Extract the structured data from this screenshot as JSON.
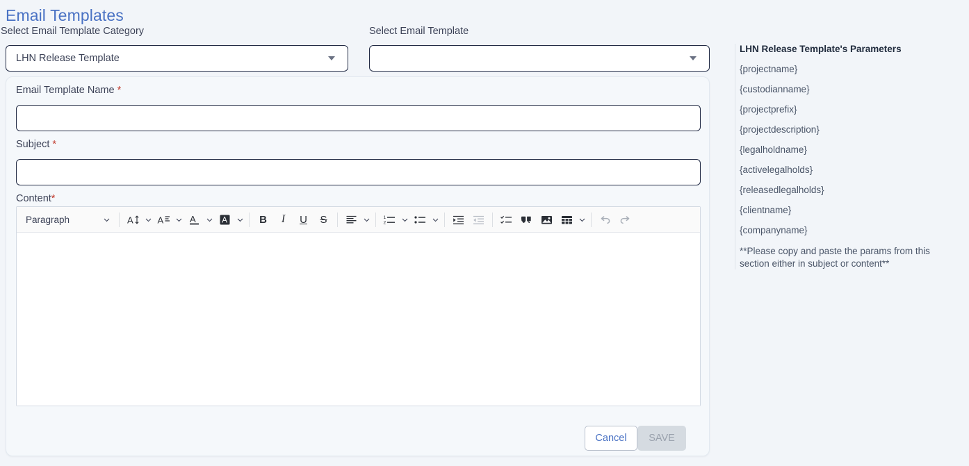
{
  "header": {
    "title": "Email Templates",
    "category_label": "Select Email Template Category",
    "template_label": "Select Email Template"
  },
  "selects": {
    "category": {
      "value": "LHN Release Template",
      "caret_icon": "chevron-down-icon"
    },
    "template": {
      "value": "",
      "placeholder": "",
      "caret_icon": "chevron-down-icon"
    }
  },
  "form": {
    "name_label": "Email Template Name",
    "name_required": "*",
    "name_value": "",
    "subject_label": "Subject",
    "subject_required": "*",
    "subject_value": "",
    "content_label": "Content",
    "content_required": "*",
    "content_value": ""
  },
  "editor": {
    "paragraph_style": "Paragraph",
    "buttons": [
      {
        "name": "font-size-icon",
        "label": ""
      },
      {
        "name": "font-family-icon",
        "label": ""
      },
      {
        "name": "font-color-icon",
        "label": ""
      },
      {
        "name": "highlight-color-icon",
        "label": ""
      },
      {
        "name": "bold-icon",
        "label": "B"
      },
      {
        "name": "italic-icon",
        "label": "I"
      },
      {
        "name": "underline-icon",
        "label": "U"
      },
      {
        "name": "strikethrough-icon",
        "label": "S"
      },
      {
        "name": "align-icon",
        "label": ""
      },
      {
        "name": "numbered-list-icon",
        "label": ""
      },
      {
        "name": "bulleted-list-icon",
        "label": ""
      },
      {
        "name": "indent-icon",
        "label": ""
      },
      {
        "name": "outdent-icon",
        "label": ""
      },
      {
        "name": "todo-list-icon",
        "label": ""
      },
      {
        "name": "blockquote-icon",
        "label": ""
      },
      {
        "name": "insert-image-icon",
        "label": ""
      },
      {
        "name": "insert-table-icon",
        "label": ""
      },
      {
        "name": "undo-icon",
        "label": ""
      },
      {
        "name": "redo-icon",
        "label": ""
      }
    ]
  },
  "footer": {
    "cancel_label": "Cancel",
    "save_label": "SAVE"
  },
  "sidebar": {
    "title": "LHN Release Template's Parameters",
    "params": [
      "{projectname}",
      "{custodianname}",
      "{projectprefix}",
      "{projectdescription}",
      "{legalholdname}",
      "{activelegalholds}",
      "{releasedlegalholds}",
      "{clientname}",
      "{companyname}"
    ],
    "note": "**Please copy and paste the params from this section either in subject or content**"
  },
  "colors": {
    "page_bg": "#f2f5f9",
    "title": "#4a72c4",
    "required": "#c0392b",
    "input_border": "#222b45",
    "cancel_text": "#4a72c4",
    "save_bg": "#d5dbe1"
  }
}
